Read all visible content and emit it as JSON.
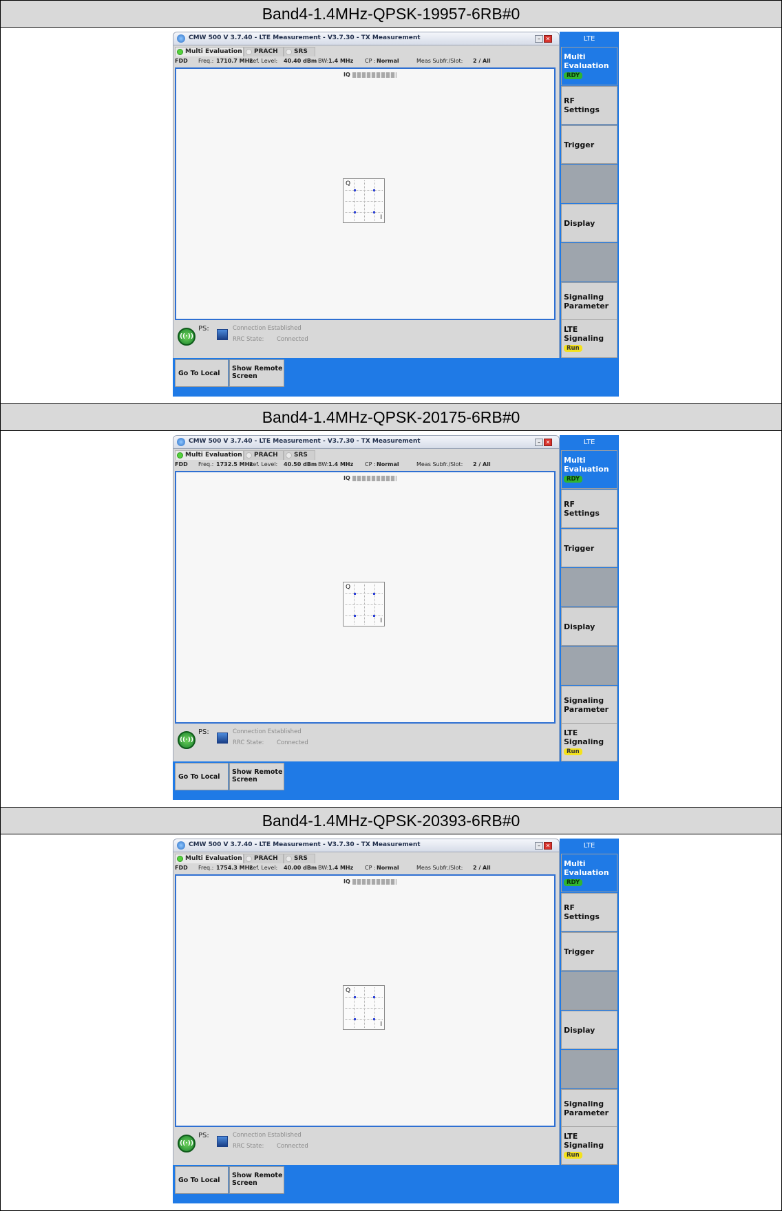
{
  "sections": [
    {
      "header": "Band4-1.4MHz-QPSK-19957-6RB#0",
      "window_title": "CMW 500 V 3.7.40 - LTE Measurement - V3.7.30 - TX Measurement",
      "tabs": [
        "Multi Evaluation",
        "PRACH",
        "SRS"
      ],
      "info": {
        "mode": "FDD",
        "freq_label": "Freq.:",
        "freq_value": "1710.7 MHz",
        "ref_label": "Ref. Level:",
        "ref_value": "40.40 dBm",
        "bw_label": "BW:",
        "bw_value": "1.4 MHz",
        "cp_label": "CP :",
        "cp_value": "Normal",
        "meas_label": "Meas Subfr./Slot:",
        "meas_value": "2 / All"
      },
      "plot": {
        "title": "IQ",
        "q_axis": "Q",
        "i_axis": "I"
      },
      "constellation_points": [
        [
          -1,
          1
        ],
        [
          1,
          1
        ],
        [
          -1,
          -1
        ],
        [
          1,
          -1
        ]
      ],
      "status": {
        "ps_label": "PS:",
        "connection": "Connection Established",
        "rrc_label": "RRC State:",
        "rrc_value": "Connected"
      },
      "bottom": {
        "local": "Go To Local",
        "remote_line1": "Show Remote",
        "remote_line2": "Screen"
      },
      "sidebar": {
        "header": "LTE",
        "multi_line1": "Multi",
        "multi_line2": "Evaluation",
        "multi_badge": "RDY",
        "rf_line1": "RF",
        "rf_line2": "Settings",
        "trigger": "Trigger",
        "display": "Display",
        "sig_line1": "Signaling",
        "sig_line2": "Parameter",
        "lte_line1": "LTE",
        "lte_line2": "Signaling",
        "lte_badge": "Run"
      }
    },
    {
      "header": "Band4-1.4MHz-QPSK-20175-6RB#0",
      "window_title": "CMW 500 V 3.7.40 - LTE Measurement - V3.7.30 - TX Measurement",
      "tabs": [
        "Multi Evaluation",
        "PRACH",
        "SRS"
      ],
      "info": {
        "mode": "FDD",
        "freq_label": "Freq.:",
        "freq_value": "1732.5 MHz",
        "ref_label": "Ref. Level:",
        "ref_value": "40.50 dBm",
        "bw_label": "BW:",
        "bw_value": "1.4 MHz",
        "cp_label": "CP :",
        "cp_value": "Normal",
        "meas_label": "Meas Subfr./Slot:",
        "meas_value": "2 / All"
      },
      "plot": {
        "title": "IQ",
        "q_axis": "Q",
        "i_axis": "I"
      },
      "constellation_points": [
        [
          -1,
          1
        ],
        [
          1,
          1
        ],
        [
          -1,
          -1
        ],
        [
          1,
          -1
        ]
      ],
      "status": {
        "ps_label": "PS:",
        "connection": "Connection Established",
        "rrc_label": "RRC State:",
        "rrc_value": "Connected"
      },
      "bottom": {
        "local": "Go To Local",
        "remote_line1": "Show Remote",
        "remote_line2": "Screen"
      },
      "sidebar": {
        "header": "LTE",
        "multi_line1": "Multi",
        "multi_line2": "Evaluation",
        "multi_badge": "RDY",
        "rf_line1": "RF",
        "rf_line2": "Settings",
        "trigger": "Trigger",
        "display": "Display",
        "sig_line1": "Signaling",
        "sig_line2": "Parameter",
        "lte_line1": "LTE",
        "lte_line2": "Signaling",
        "lte_badge": "Run"
      }
    },
    {
      "header": "Band4-1.4MHz-QPSK-20393-6RB#0",
      "window_title": "CMW 500 V 3.7.40 - LTE Measurement - V3.7.30 - TX Measurement",
      "tabs": [
        "Multi Evaluation",
        "PRACH",
        "SRS"
      ],
      "info": {
        "mode": "FDD",
        "freq_label": "Freq.:",
        "freq_value": "1754.3 MHz",
        "ref_label": "Ref. Level:",
        "ref_value": "40.00 dBm",
        "bw_label": "BW:",
        "bw_value": "1.4 MHz",
        "cp_label": "CP :",
        "cp_value": "Normal",
        "meas_label": "Meas Subfr./Slot:",
        "meas_value": "2 / All"
      },
      "plot": {
        "title": "IQ",
        "q_axis": "Q",
        "i_axis": "I"
      },
      "constellation_points": [
        [
          -1,
          1
        ],
        [
          1,
          1
        ],
        [
          -1,
          -1
        ],
        [
          1,
          -1
        ]
      ],
      "status": {
        "ps_label": "PS:",
        "connection": "Connection Established",
        "rrc_label": "RRC State:",
        "rrc_value": "Connected"
      },
      "bottom": {
        "local": "Go To Local",
        "remote_line1": "Show Remote",
        "remote_line2": "Screen"
      },
      "sidebar": {
        "header": "LTE",
        "multi_line1": "Multi",
        "multi_line2": "Evaluation",
        "multi_badge": "RDY",
        "rf_line1": "RF",
        "rf_line2": "Settings",
        "trigger": "Trigger",
        "display": "Display",
        "sig_line1": "Signaling",
        "sig_line2": "Parameter",
        "lte_line1": "LTE",
        "lte_line2": "Signaling",
        "lte_badge": "Run"
      }
    }
  ]
}
